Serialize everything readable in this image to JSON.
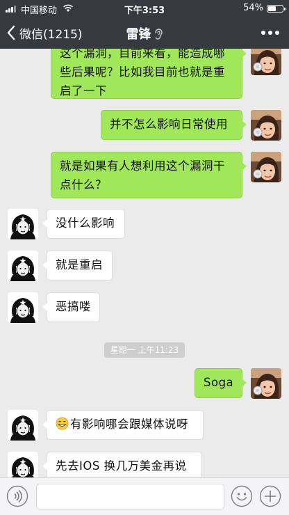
{
  "status_bar": {
    "carrier": "中国移动",
    "time": "下午3:53",
    "battery_percent_text": "54%",
    "battery_level": 0.54
  },
  "nav": {
    "back_label": "微信(1215)",
    "title": "雷锋"
  },
  "messages": [
    {
      "from": "me",
      "text": "这个漏洞，目前来看，能造成哪些后果呢？比如我目前也就是重启了一下"
    },
    {
      "from": "me",
      "text": "并不怎么影响日常使用"
    },
    {
      "from": "me",
      "text": "就是如果有人想利用这个漏洞干点什么？"
    },
    {
      "from": "other",
      "text": "没什么影响"
    },
    {
      "from": "other",
      "text": "就是重启"
    },
    {
      "from": "other",
      "text": "恶搞喽"
    },
    {
      "from": "me",
      "text": "Soga"
    },
    {
      "from": "other",
      "text": "有影响哪会跟媒体说呀",
      "icon": "grin-emoji-icon"
    },
    {
      "from": "other",
      "text": "先去IOS  换几万美金再说"
    }
  ],
  "timestamp": "星期一 上午11:23",
  "input": {
    "placeholder": ""
  },
  "icons": {
    "back": "chevron-left-icon",
    "title_badge": "ear-icon",
    "more": "more-dots-icon",
    "voice": "voice-icon",
    "face": "face-icon",
    "plus": "plus-icon"
  },
  "colors": {
    "nav_background": "#363a3e",
    "chat_background": "#ebebeb",
    "my_bubble": "#a0e75a",
    "other_bubble": "#ffffff",
    "timestamp_pill": "#cecece"
  }
}
